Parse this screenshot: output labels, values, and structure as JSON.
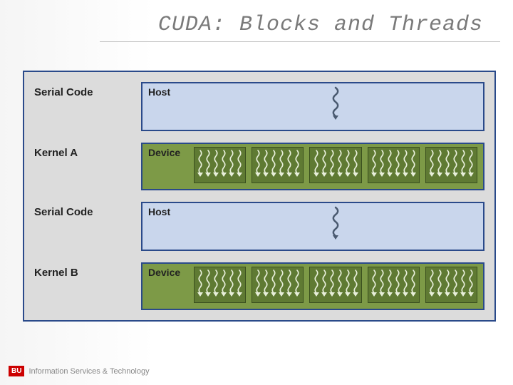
{
  "title": "CUDA: Blocks and Threads",
  "rows": [
    {
      "label": "Serial Code",
      "box_type": "host",
      "box_label": "Host"
    },
    {
      "label": "Kernel A",
      "box_type": "device",
      "box_label": "Device"
    },
    {
      "label": "Serial Code",
      "box_type": "host",
      "box_label": "Host"
    },
    {
      "label": "Kernel B",
      "box_type": "device",
      "box_label": "Device"
    }
  ],
  "blocks_per_device": 5,
  "threads_per_block": 6,
  "footer": {
    "badge": "BU",
    "text": "Information Services & Technology"
  },
  "colors": {
    "host_bg": "#c9d6ec",
    "device_bg": "#7d9a47",
    "block_bg": "#5f7a33",
    "border": "#2a4a8a"
  }
}
